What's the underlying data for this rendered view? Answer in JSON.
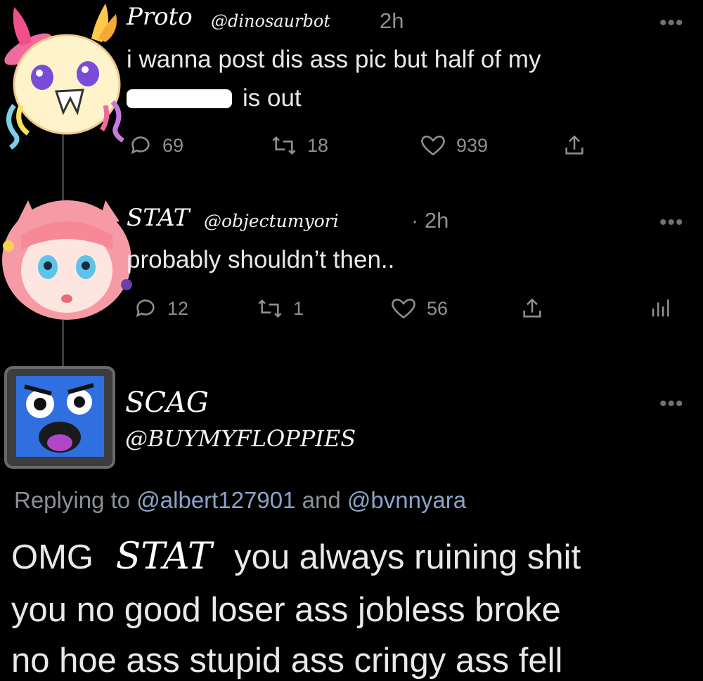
{
  "tweet1": {
    "name": "Proto",
    "handle": "@dinosaurbot",
    "time": "2h",
    "text_line1": "i wanna post dis ass pic but half of my",
    "text_line2": "is out",
    "replies": "69",
    "retweets": "18",
    "likes": "939"
  },
  "tweet2": {
    "name": "STAT",
    "handle": "@objectumyori",
    "time": "· 2h",
    "text": "probably shouldn’t then..",
    "replies": "12",
    "retweets": "1",
    "likes": "56"
  },
  "tweet3": {
    "name": "SCAG",
    "handle": "@BUYMYFLOPPIES",
    "replying_prefix": "Replying to",
    "mention1": "@albert127901",
    "and": "and",
    "mention2": "@bvnnyara",
    "line1_start": "OMG",
    "line1_name": "STAT",
    "line1_end": "you always ruining shit",
    "line2": "you no good loser ass jobless broke",
    "line3": "no hoe ass stupid ass cringy ass fell"
  },
  "more_glyph": "•••",
  "icons": [
    "reply-icon",
    "retweet-icon",
    "like-icon",
    "share-icon",
    "analytics-icon",
    "more-icon"
  ]
}
